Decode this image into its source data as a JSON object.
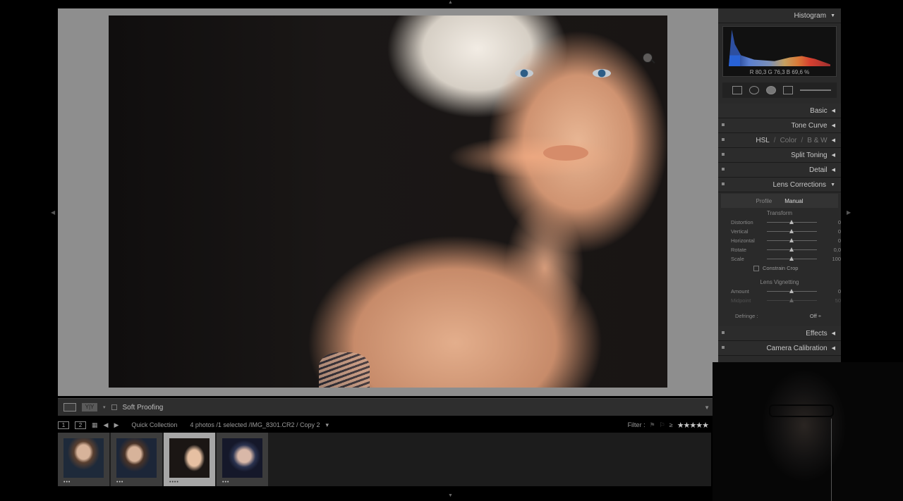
{
  "toolbar": {
    "soft_proofing_label": "Soft Proofing",
    "compare_label": "Y|Y"
  },
  "filmbar": {
    "view1": "1",
    "view2": "2",
    "source": "Quick Collection",
    "info": "4 photos /1 selected /IMG_8301.CR2 / Copy 2",
    "info_arrow": "▾",
    "filter_label": "Filter :",
    "rating_prefix": "≥",
    "stars": "★★★★★"
  },
  "filmstrip": {
    "thumbs": [
      {
        "dots": "•••"
      },
      {
        "dots": "•••"
      },
      {
        "dots": "••••"
      },
      {
        "dots": "•••"
      }
    ]
  },
  "panel": {
    "histogram": "Histogram",
    "histogram_readout": "R 80,3  G 76,3  B 69,6 %",
    "basic": "Basic",
    "tone_curve": "Tone Curve",
    "hsl": "HSL",
    "color": "Color",
    "bw": "B & W",
    "split_toning": "Split Toning",
    "detail": "Detail",
    "lens_corrections": "Lens Corrections",
    "tab_profile": "Profile",
    "tab_manual": "Manual",
    "transform_label": "Transform",
    "distortion": {
      "label": "Distortion",
      "value": "0"
    },
    "vertical": {
      "label": "Vertical",
      "value": "0"
    },
    "horizontal": {
      "label": "Horizontal",
      "value": "0"
    },
    "rotate": {
      "label": "Rotate",
      "value": "0,0"
    },
    "scale": {
      "label": "Scale",
      "value": "100"
    },
    "constrain_crop": "Constrain Crop",
    "lens_vignetting_label": "Lens Vignetting",
    "amount": {
      "label": "Amount",
      "value": "0"
    },
    "midpoint": {
      "label": "Midpoint",
      "value": "50"
    },
    "defringe": "Defringe :",
    "defringe_value": "Off ÷",
    "effects": "Effects",
    "camera_calibration": "Camera Calibration"
  }
}
